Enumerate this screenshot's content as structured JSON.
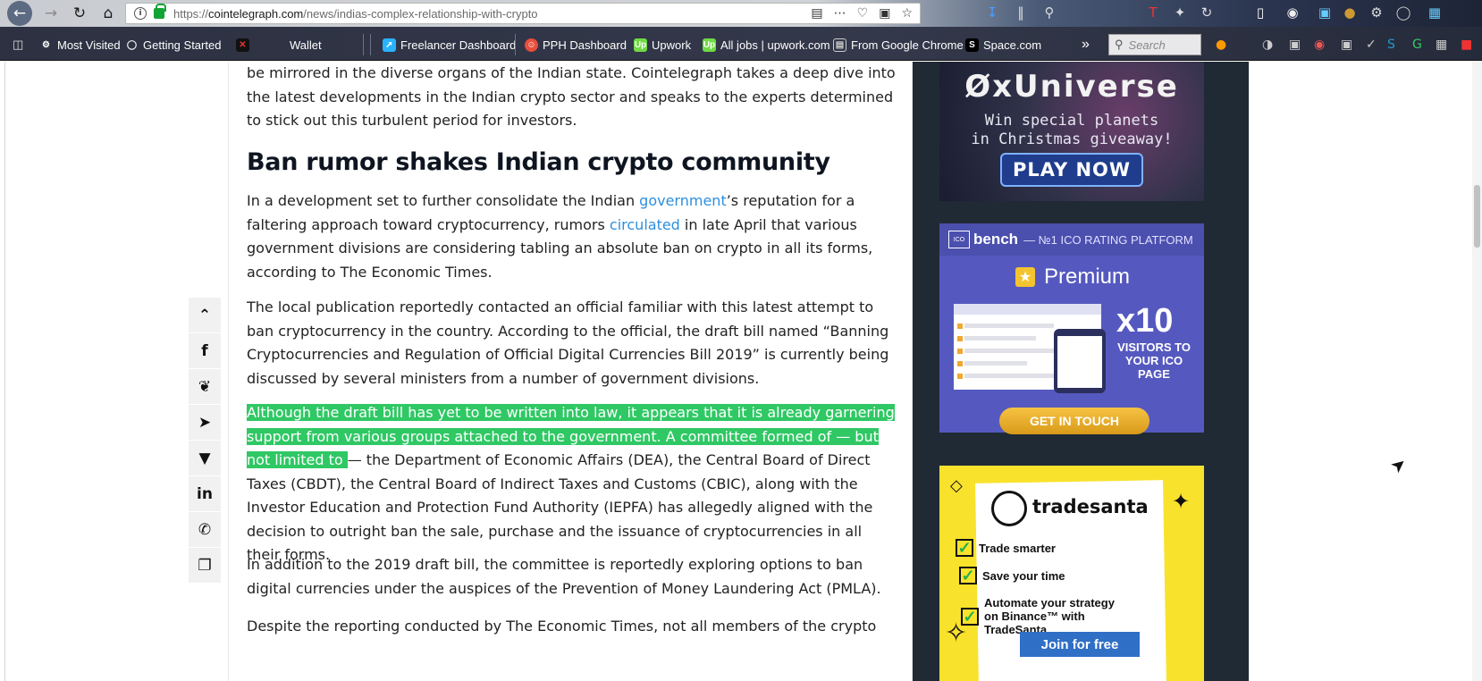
{
  "browser": {
    "url_domain": "cointelegraph.com",
    "url_path": "/news/indias-complex-relationship-with-crypto",
    "url_scheme": "https://",
    "search_placeholder": "Search",
    "bookmarks": [
      {
        "label": "Most Visited",
        "icon": "gear-icon"
      },
      {
        "label": "Getting Started",
        "icon": "globe-icon"
      },
      {
        "label": "",
        "icon": "x-icon"
      },
      {
        "label": "Wallet",
        "icon": "wallet-icon"
      },
      {
        "label": "Freelancer Dashboard",
        "icon": "freelancer-icon"
      },
      {
        "label": "PPH Dashboard",
        "icon": "pph-icon"
      },
      {
        "label": "Upwork",
        "icon": "upwork-icon"
      },
      {
        "label": "All jobs | upwork.com",
        "icon": "upwork-icon"
      },
      {
        "label": "From Google Chrome",
        "icon": "folder-icon"
      },
      {
        "label": "Space.com",
        "icon": "space-icon"
      }
    ]
  },
  "article": {
    "intro": "be mirrored in the diverse organs of the Indian state. Cointelegraph takes a deep dive into the latest developments in the Indian crypto sector and speaks to the experts determined to stick out this turbulent period for investors.",
    "heading": "Ban rumor shakes Indian crypto community",
    "p1_a": "In a development set to further consolidate the Indian ",
    "p1_link1": "government",
    "p1_b": "’s reputation for a faltering approach toward cryptocurrency, rumors ",
    "p1_link2": "circulated",
    "p1_c": " in late April that various government divisions are considering tabling an absolute ban on crypto in all its forms, according to The Economic Times.",
    "p2": "The local publication reportedly contacted an official familiar with this latest attempt to ban cryptocurrency in the country. According to the official, the draft bill named “Banning Cryptocurrencies and Regulation of Official Digital Currencies Bill 2019” is currently being discussed by several ministers from a number of government divisions.",
    "p3_highlight": "Although the draft bill has yet to be written into law, it appears that it is already garnering support from various groups attached to the government. A committee formed of — but not limited to ",
    "p3_rest": "— the Department of Economic Affairs (DEA), the Central Board of Direct Taxes (CBDT), the Central Board of Indirect Taxes and Customs (CBIC), along with the Investor Education and Protection Fund Authority (IEPFA) has allegedly aligned with the decision to outright ban the sale, purchase and the issuance of cryptocurrencies in all their forms.",
    "p4": "In addition to the 2019 draft bill, the committee is reportedly exploring options to ban digital currencies under the auspices of the Prevention of Money Laundering Act (PMLA).",
    "p5": "Despite the reporting conducted by The Economic Times, not all members of the crypto"
  },
  "share_icons": [
    "chevron-up-icon",
    "facebook-icon",
    "twitter-icon",
    "telegram-icon",
    "pocket-icon",
    "linkedin-icon",
    "whatsapp-icon",
    "copy-icon"
  ],
  "ads": {
    "ad1": {
      "title": "ØxUniverse",
      "line1": "Win special planets",
      "line2": "in Christmas giveaway!",
      "button": "PLAY NOW"
    },
    "ad2": {
      "logo": "ICO",
      "brand": "bench",
      "tagline": "— №1 ICO RATING PLATFORM",
      "premium": "Premium",
      "big": "x10",
      "visitors": "VISITORS TO YOUR ICO PAGE",
      "button": "GET IN TOUCH"
    },
    "ad3": {
      "brand": "tradesanta",
      "items": [
        "Trade smarter",
        "Save your time",
        "Automate your strategy on Binance™ with TradeSanta"
      ],
      "button": "Join for free"
    }
  },
  "colors": {
    "highlight": "#2fc864",
    "link": "#2d8fe0"
  }
}
